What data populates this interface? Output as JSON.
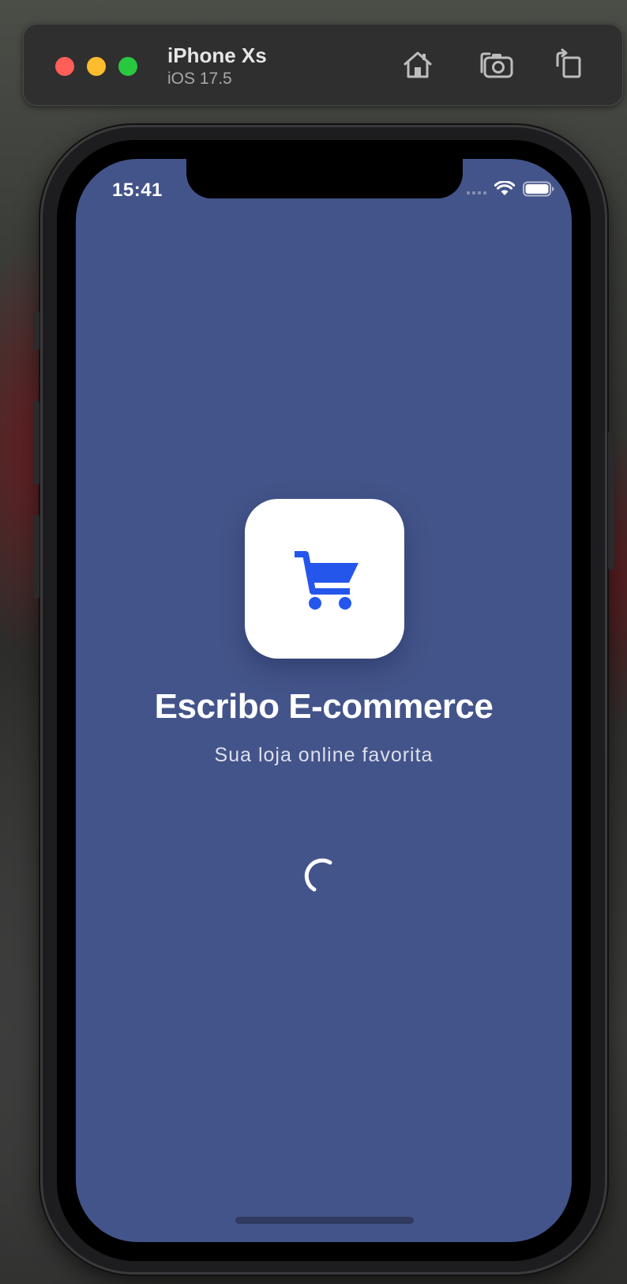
{
  "simulator": {
    "device_name": "iPhone Xs",
    "os_version": "iOS 17.5",
    "icons": [
      "home-icon",
      "screenshot-icon",
      "rotate-icon"
    ]
  },
  "status_bar": {
    "time": "15:41",
    "icons": [
      "cellular-signal-icon",
      "wifi-icon",
      "battery-icon"
    ]
  },
  "splash": {
    "logo_icon": "shopping-cart-icon",
    "title": "Escribo E-commerce",
    "subtitle": "Sua loja online favorita",
    "loading": "activity-spinner"
  },
  "colors": {
    "screen_background": "#43548a",
    "logo_background": "#ffffff",
    "cart_icon": "#2456ec",
    "traffic_red": "#ff5f57",
    "traffic_yellow": "#febc2e",
    "traffic_green": "#28c840"
  }
}
